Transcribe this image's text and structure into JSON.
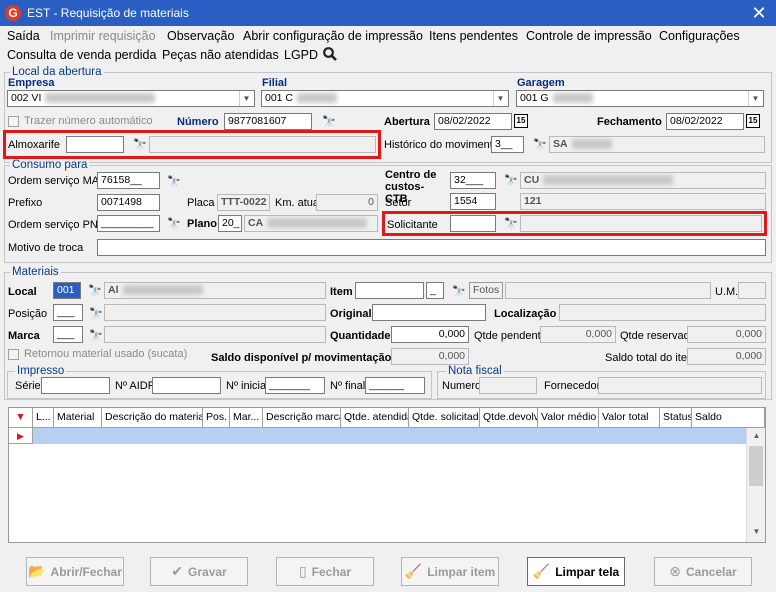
{
  "window": {
    "title": "EST - Requisição de materiais",
    "logo": "G",
    "close": "✕"
  },
  "menu": [
    "Saída",
    "Imprimir requisição",
    "Observação",
    "Abrir configuração de impressão",
    "Itens pendentes",
    "Controle de impressão",
    "Configurações",
    "Consulta de venda perdida",
    "Peças não atendidas",
    "LGPD"
  ],
  "local": {
    "group_title": "Local da abertura",
    "empresa_label": "Empresa",
    "empresa_value": "002 VI",
    "filial_label": "Filial",
    "filial_value": "001 C",
    "garagem_label": "Garagem",
    "garagem_value": "001 G",
    "trazer_label": "Trazer número automático",
    "numero_label": "Número",
    "numero_value": "9877081607",
    "abertura_label": "Abertura",
    "abertura_value": "08/02/2022",
    "fechamento_label": "Fechamento",
    "fechamento_value": "08/02/2022",
    "almoxarife_label": "Almoxarife",
    "almoxarife_value": "",
    "historico_label": "Histórico do movimento",
    "historico_value": "3__",
    "historico_desc": "SA"
  },
  "consumo": {
    "group_title": "Consumo para",
    "os_man_label": "Ordem serviço MAN",
    "os_man_value": "76158__",
    "prefixo_label": "Prefixo",
    "prefixo_value": "0071498",
    "placa_label": "Placa",
    "placa_value": "TTT-0022",
    "km_label": "Km. atual",
    "km_value": "0",
    "os_pne_label": "Ordem serviço PNE",
    "os_pne_value": "_________",
    "plano_label": "Plano",
    "plano_value": "20_",
    "plano_desc": "CA",
    "centro_label": "Centro de custos-CTB",
    "centro_value": "32___",
    "centro_desc": "CU",
    "setor_label": "Setor",
    "setor_value": "1554",
    "setor_desc": "121",
    "solicitante_label": "Solicitante",
    "solicitante_value": "",
    "motivo_label": "Motivo de troca",
    "motivo_value": ""
  },
  "materiais": {
    "group_title": "Materiais",
    "local_label": "Local",
    "local_value": "001",
    "local_desc": "Al",
    "item_label": "Item",
    "item_value": "",
    "item_suffix": "_",
    "fotos_label": "Fotos",
    "um_label": "U.M.",
    "posicao_label": "Posição",
    "posicao_value": "___",
    "original_label": "Original",
    "localizacao_label": "Localização",
    "marca_label": "Marca",
    "marca_value": "___",
    "quantidade_label": "Quantidade",
    "quantidade_value": "0,000",
    "qtde_pendente_label": "Qtde pendente",
    "qtde_pendente_value": "0,000",
    "qtde_reservada_label": "Qtde reservada",
    "qtde_reservada_value": "0,000",
    "retornou_label": "Retornou material usado (sucata)",
    "saldo_disp_label": "Saldo disponível p/ movimentação",
    "saldo_disp_value": "0,000",
    "saldo_total_label": "Saldo total do item",
    "saldo_total_value": "0,000"
  },
  "impresso": {
    "group_title": "Impresso",
    "serie_label": "Série",
    "serie_value": "",
    "aidf_label": "Nº AIDF",
    "aidf_value": "",
    "inicial_label": "Nº inicial",
    "inicial_value": "_______",
    "final_label": "Nº final",
    "final_value": "______"
  },
  "nota": {
    "group_title": "Nota fiscal",
    "numero_label": "Numero",
    "fornecedor_label": "Fornecedor"
  },
  "grid": {
    "columns": [
      "L...",
      "Material",
      "Descrição do material",
      "Pos.",
      "Mar...",
      "Descrição marca",
      "Qtde. atendida",
      "Qtde. solicitada",
      "Qtde.devolv.",
      "Valor médio",
      "Valor total",
      "Status",
      "Saldo"
    ]
  },
  "buttons": {
    "abrir": "Abrir/Fechar",
    "gravar": "Gravar",
    "fechar": "Fechar",
    "limpar_item": "Limpar item",
    "limpar_tela": "Limpar tela",
    "cancelar": "Cancelar"
  },
  "colors": {
    "titlebar": "#2a5ec3",
    "highlight": "#e01818",
    "group_title": "#0a3a86",
    "selected_row": "#b7cff0"
  }
}
